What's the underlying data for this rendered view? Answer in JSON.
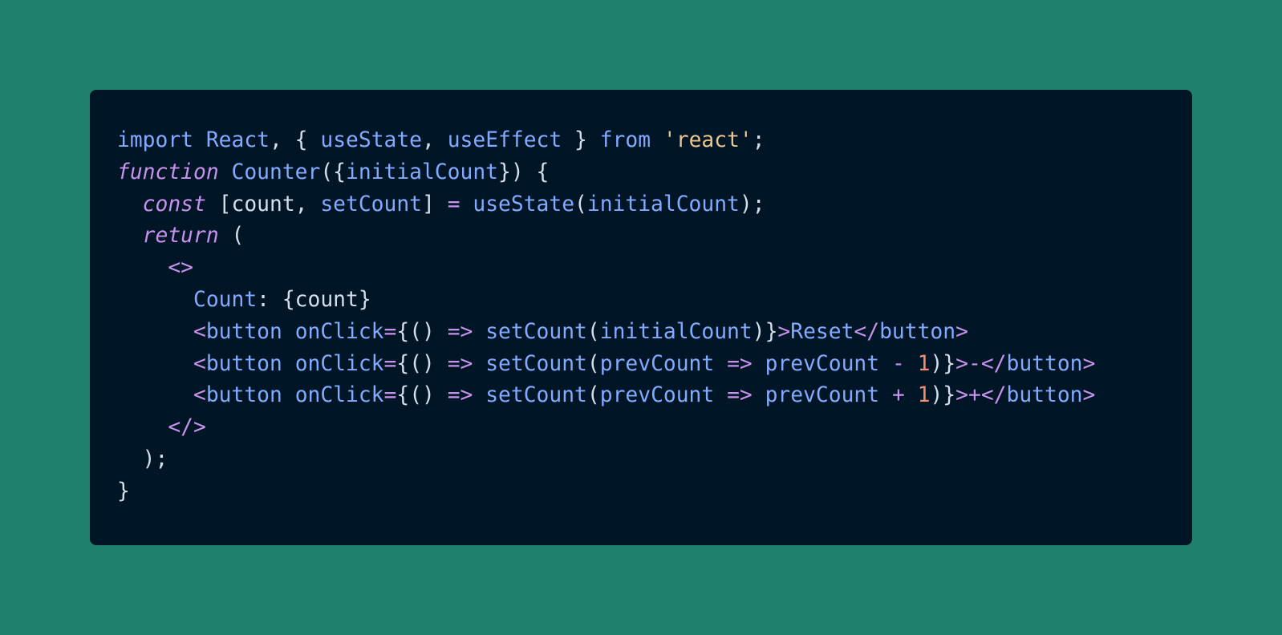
{
  "colors": {
    "background": "#1f816d",
    "panel": "#001627",
    "keyword": "#82aaff",
    "italic_keyword": "#c792ea",
    "plain": "#d6deeb",
    "operator": "#c792ea",
    "string": "#ecc48d",
    "number": "#f78c6c"
  },
  "code": {
    "language": "jsx",
    "lines": [
      [
        {
          "t": "import",
          "c": "keyword"
        },
        {
          "t": " ",
          "c": "plain"
        },
        {
          "t": "React",
          "c": "ident"
        },
        {
          "t": ", { ",
          "c": "punct"
        },
        {
          "t": "useState",
          "c": "ident"
        },
        {
          "t": ", ",
          "c": "punct"
        },
        {
          "t": "useEffect",
          "c": "ident"
        },
        {
          "t": " } ",
          "c": "punct"
        },
        {
          "t": "from",
          "c": "keyword"
        },
        {
          "t": " ",
          "c": "plain"
        },
        {
          "t": "'",
          "c": "string"
        },
        {
          "t": "react",
          "c": "string"
        },
        {
          "t": "'",
          "c": "string"
        },
        {
          "t": ";",
          "c": "punct"
        }
      ],
      [
        {
          "t": "function",
          "c": "italic"
        },
        {
          "t": " ",
          "c": "plain"
        },
        {
          "t": "Counter",
          "c": "ident"
        },
        {
          "t": "({",
          "c": "punct"
        },
        {
          "t": "initialCount",
          "c": "ident"
        },
        {
          "t": "}) {",
          "c": "punct"
        }
      ],
      [
        {
          "t": "  ",
          "c": "plain"
        },
        {
          "t": "const",
          "c": "italic"
        },
        {
          "t": " [count, ",
          "c": "plain"
        },
        {
          "t": "setCount",
          "c": "ident"
        },
        {
          "t": "] ",
          "c": "plain"
        },
        {
          "t": "=",
          "c": "operator"
        },
        {
          "t": " ",
          "c": "plain"
        },
        {
          "t": "useState",
          "c": "ident"
        },
        {
          "t": "(",
          "c": "punct"
        },
        {
          "t": "initialCount",
          "c": "ident"
        },
        {
          "t": ");",
          "c": "punct"
        }
      ],
      [
        {
          "t": "  ",
          "c": "plain"
        },
        {
          "t": "return",
          "c": "italic"
        },
        {
          "t": " (",
          "c": "punct"
        }
      ],
      [
        {
          "t": "    ",
          "c": "plain"
        },
        {
          "t": "<>",
          "c": "operator"
        }
      ],
      [
        {
          "t": "      ",
          "c": "plain"
        },
        {
          "t": "Count",
          "c": "ident"
        },
        {
          "t": ": {count}",
          "c": "plain"
        }
      ],
      [
        {
          "t": "      ",
          "c": "plain"
        },
        {
          "t": "<",
          "c": "operator"
        },
        {
          "t": "button",
          "c": "ident"
        },
        {
          "t": " ",
          "c": "plain"
        },
        {
          "t": "onClick",
          "c": "ident"
        },
        {
          "t": "=",
          "c": "operator"
        },
        {
          "t": "{() ",
          "c": "punct"
        },
        {
          "t": "=>",
          "c": "operator"
        },
        {
          "t": " ",
          "c": "plain"
        },
        {
          "t": "setCount",
          "c": "ident"
        },
        {
          "t": "(",
          "c": "punct"
        },
        {
          "t": "initialCount",
          "c": "ident"
        },
        {
          "t": ")}",
          "c": "punct"
        },
        {
          "t": ">",
          "c": "operator"
        },
        {
          "t": "Reset",
          "c": "ident"
        },
        {
          "t": "</",
          "c": "operator"
        },
        {
          "t": "button",
          "c": "ident"
        },
        {
          "t": ">",
          "c": "operator"
        }
      ],
      [
        {
          "t": "      ",
          "c": "plain"
        },
        {
          "t": "<",
          "c": "operator"
        },
        {
          "t": "button",
          "c": "ident"
        },
        {
          "t": " ",
          "c": "plain"
        },
        {
          "t": "onClick",
          "c": "ident"
        },
        {
          "t": "=",
          "c": "operator"
        },
        {
          "t": "{() ",
          "c": "punct"
        },
        {
          "t": "=>",
          "c": "operator"
        },
        {
          "t": " ",
          "c": "plain"
        },
        {
          "t": "setCount",
          "c": "ident"
        },
        {
          "t": "(",
          "c": "punct"
        },
        {
          "t": "prevCount",
          "c": "ident"
        },
        {
          "t": " ",
          "c": "plain"
        },
        {
          "t": "=>",
          "c": "operator"
        },
        {
          "t": " ",
          "c": "plain"
        },
        {
          "t": "prevCount",
          "c": "ident"
        },
        {
          "t": " ",
          "c": "plain"
        },
        {
          "t": "-",
          "c": "operator"
        },
        {
          "t": " ",
          "c": "plain"
        },
        {
          "t": "1",
          "c": "number"
        },
        {
          "t": ")}",
          "c": "punct"
        },
        {
          "t": ">",
          "c": "operator"
        },
        {
          "t": "-",
          "c": "operator"
        },
        {
          "t": "</",
          "c": "operator"
        },
        {
          "t": "button",
          "c": "ident"
        },
        {
          "t": ">",
          "c": "operator"
        }
      ],
      [
        {
          "t": "      ",
          "c": "plain"
        },
        {
          "t": "<",
          "c": "operator"
        },
        {
          "t": "button",
          "c": "ident"
        },
        {
          "t": " ",
          "c": "plain"
        },
        {
          "t": "onClick",
          "c": "ident"
        },
        {
          "t": "=",
          "c": "operator"
        },
        {
          "t": "{() ",
          "c": "punct"
        },
        {
          "t": "=>",
          "c": "operator"
        },
        {
          "t": " ",
          "c": "plain"
        },
        {
          "t": "setCount",
          "c": "ident"
        },
        {
          "t": "(",
          "c": "punct"
        },
        {
          "t": "prevCount",
          "c": "ident"
        },
        {
          "t": " ",
          "c": "plain"
        },
        {
          "t": "=>",
          "c": "operator"
        },
        {
          "t": " ",
          "c": "plain"
        },
        {
          "t": "prevCount",
          "c": "ident"
        },
        {
          "t": " ",
          "c": "plain"
        },
        {
          "t": "+",
          "c": "operator"
        },
        {
          "t": " ",
          "c": "plain"
        },
        {
          "t": "1",
          "c": "number"
        },
        {
          "t": ")}",
          "c": "punct"
        },
        {
          "t": ">",
          "c": "operator"
        },
        {
          "t": "+",
          "c": "operator"
        },
        {
          "t": "</",
          "c": "operator"
        },
        {
          "t": "button",
          "c": "ident"
        },
        {
          "t": ">",
          "c": "operator"
        }
      ],
      [
        {
          "t": "    ",
          "c": "plain"
        },
        {
          "t": "</>",
          "c": "operator"
        }
      ],
      [
        {
          "t": "  ",
          "c": "plain"
        },
        {
          "t": ");",
          "c": "punct"
        }
      ],
      [
        {
          "t": "}",
          "c": "punct"
        }
      ]
    ]
  }
}
